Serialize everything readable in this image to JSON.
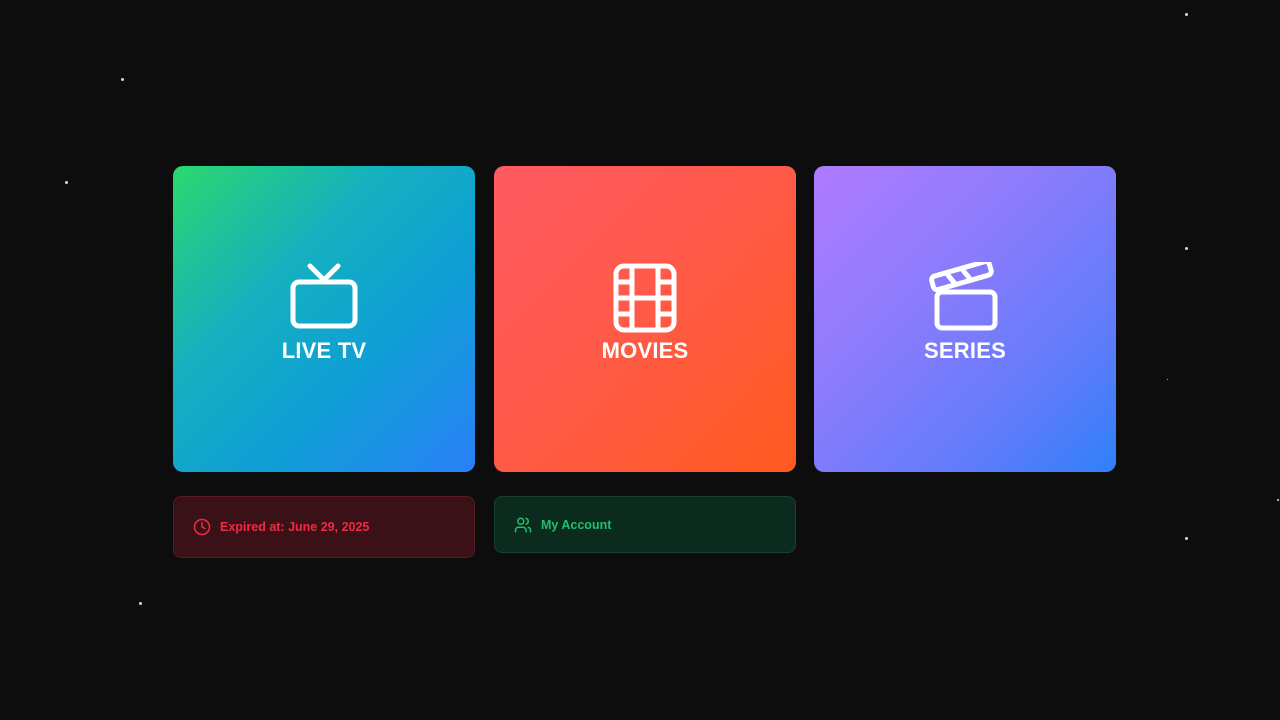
{
  "tiles": [
    {
      "id": "live-tv",
      "label": "LIVE TV",
      "icon": "tv-icon"
    },
    {
      "id": "movies",
      "label": "MOVIES",
      "icon": "film-icon"
    },
    {
      "id": "series",
      "label": "SERIES",
      "icon": "clapperboard-icon"
    }
  ],
  "status": {
    "expiry_label": "Expired at: June 29, 2025",
    "expiry_icon": "clock-icon",
    "account_label": "My Account",
    "account_icon": "users-icon"
  },
  "colors": {
    "background": "#0d0d0e",
    "expiry_text": "#f02a44",
    "account_text": "#1fbf6c"
  }
}
